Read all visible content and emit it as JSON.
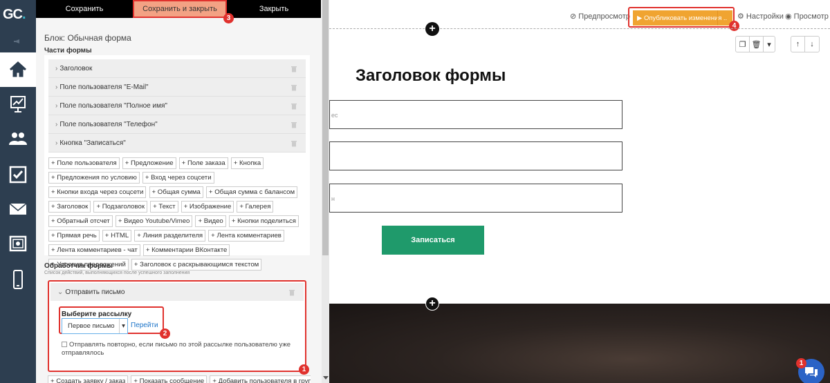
{
  "logo": {
    "text": "GC",
    "dot": "."
  },
  "rail": {
    "items": [
      "home-icon",
      "chart-icon",
      "users-icon",
      "checkbox-icon",
      "mail-icon",
      "safe-icon",
      "mobile-icon"
    ]
  },
  "toolbar": {
    "save": "Сохранить",
    "save_close": "Сохранить и закрыть",
    "close": "Закрыть"
  },
  "badges": {
    "b1": "1",
    "b2": "2",
    "b3": "3",
    "b4": "4",
    "chat": "1"
  },
  "panel": {
    "block_title": "Блок: Обычная форма",
    "parts_title": "Части формы",
    "parts": [
      "Заголовок",
      "Поле пользователя \"E-Mail\"",
      "Поле пользователя \"Полное имя\"",
      "Поле пользователя \"Телефон\"",
      "Кнопка \"Записаться\""
    ],
    "add_buttons": [
      "+ Поле пользователя",
      "+ Предложение",
      "+ Поле заказа",
      "+ Кнопка",
      "+ Предложения по условию",
      "+ Вход через соцсети",
      "+ Кнопки входа через соцсети",
      "+ Общая сумма",
      "+ Общая сумма с балансом",
      "+ Заголовок",
      "+ Подзаголовок",
      "+ Текст",
      "+ Изображение",
      "+ Галерея",
      "+ Обратный отсчет",
      "+ Видео Youtube/Vimeo",
      "+ Видео",
      "+ Кнопки поделиться",
      "+ Прямая речь",
      "+ HTML",
      "+ Линия разделителя",
      "+ Лента комментариев",
      "+ Лента комментариев - чат",
      "+ Комментарии ВКонтакте",
      "+ Условия предложений",
      "+ Заголовок с раскрывающимся текстом"
    ],
    "handler_title": "Обработчик формы",
    "handler_sub": "Список действий, выполняющихся после успешного заполнения",
    "send_letter": "Отправить письмо",
    "mail_label": "Выберите рассылку",
    "mail_value": "Первое письмо",
    "mail_go": "Перейти",
    "resend": "Отправлять повторно, если письмо по этой рассылке пользователю уже отправлялось",
    "bottom_adds": [
      "+ Создать заявку / заказ",
      "+ Показать сообщение",
      "+ Добавить пользователя в группу"
    ]
  },
  "topbar": {
    "preview": "Предпросмотр",
    "publish": "Опубликовать изменения",
    "publish_more": "..",
    "settings": "Настройки",
    "view": "Просмотр"
  },
  "form": {
    "heading": "Заголовок формы",
    "field1_placeholder": "ес",
    "field3_placeholder": "н",
    "submit": "Записаться"
  }
}
